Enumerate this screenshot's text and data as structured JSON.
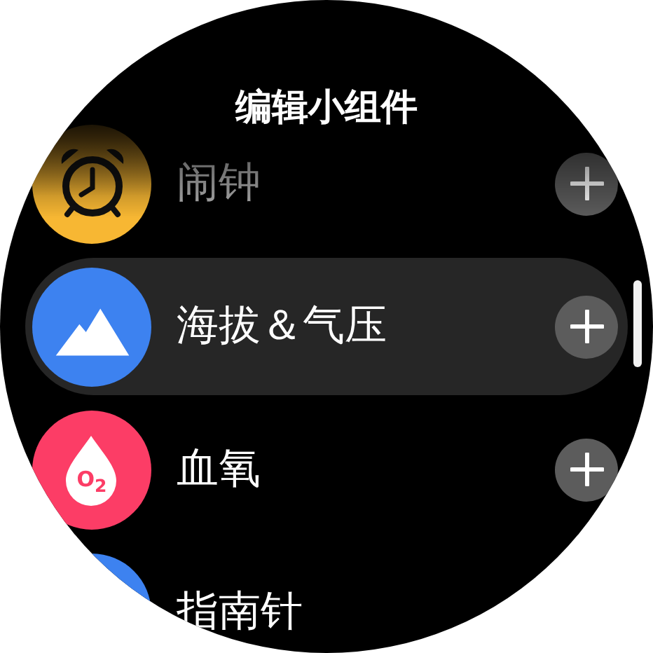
{
  "title": "编辑小组件",
  "items": [
    {
      "kind": "alarm",
      "label": "闹钟",
      "color": "#f7b733",
      "selected": false,
      "faded": true,
      "add_button": true
    },
    {
      "kind": "altitude",
      "label": "海拔＆气压",
      "color": "#3d82f0",
      "selected": true,
      "faded": false,
      "add_button": true
    },
    {
      "kind": "oxygen",
      "label": "血氧",
      "color": "#fc3d66",
      "selected": false,
      "faded": false,
      "add_button": true,
      "icon_text": "O$_{2}$"
    },
    {
      "kind": "compass",
      "label": "指南针",
      "color": "#3d82f0",
      "selected": false,
      "faded": false,
      "add_button": false
    }
  ]
}
